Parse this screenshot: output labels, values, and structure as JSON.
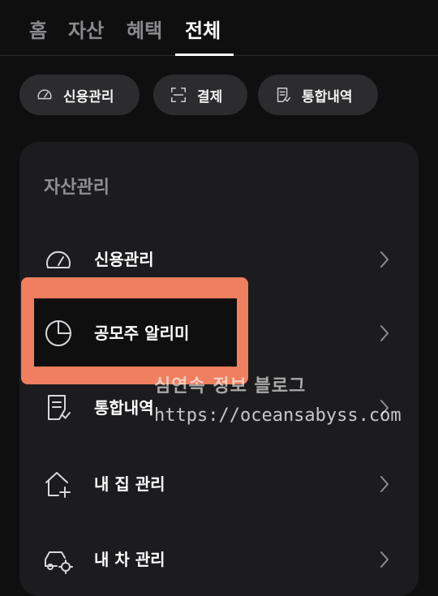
{
  "tabs": [
    {
      "label": "홈"
    },
    {
      "label": "자산"
    },
    {
      "label": "혜택"
    },
    {
      "label": "전체"
    }
  ],
  "chips": [
    {
      "label": "신용관리",
      "icon": "gauge-icon"
    },
    {
      "label": "결제",
      "icon": "scan-frame-icon"
    },
    {
      "label": "통합내역",
      "icon": "document-list-icon"
    }
  ],
  "section": {
    "title": "자산관리"
  },
  "menu": [
    {
      "label": "신용관리",
      "icon": "gauge-icon"
    },
    {
      "label": "공모주 알리미",
      "icon": "pie-chart-icon"
    },
    {
      "label": "통합내역",
      "icon": "document-list-icon"
    },
    {
      "label": "내 집 관리",
      "icon": "house-plus-icon"
    },
    {
      "label": "내 차 관리",
      "icon": "car-gear-icon"
    }
  ],
  "watermark": {
    "line1": "심연속 정보 블로그",
    "line2": "https://oceansabyss.com"
  },
  "colors": {
    "background": "#0f0f10",
    "card": "#1c1c1e",
    "chip": "#2c2c2e",
    "highlight": "#ef7f5e"
  }
}
